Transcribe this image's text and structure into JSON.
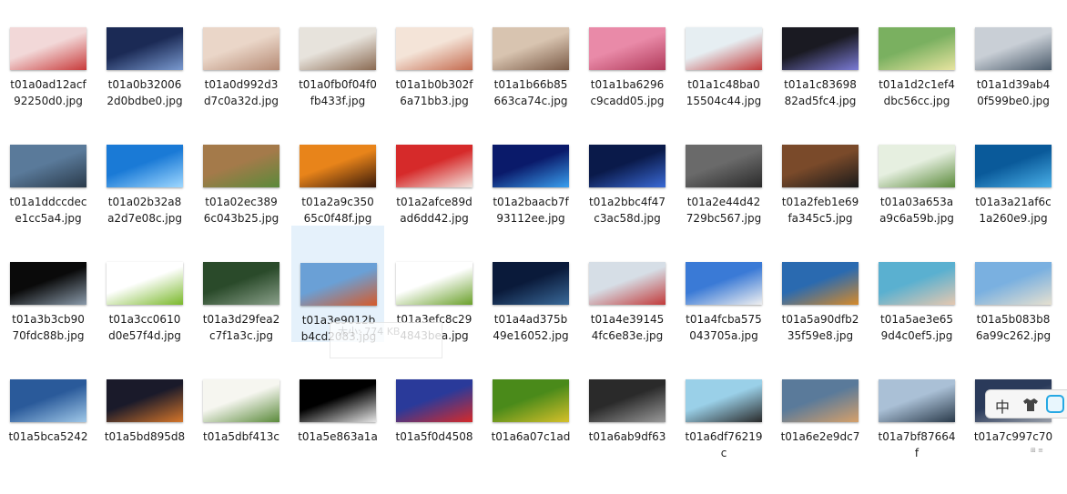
{
  "files": [
    {
      "name": "t01a0ad12acf92250d0.jpg",
      "icon": "photo-thumbnail",
      "colors": [
        "#f2d8d8",
        "#c83a3a"
      ]
    },
    {
      "name": "t01a0b320062d0bdbe0.jpg",
      "icon": "photo-thumbnail",
      "colors": [
        "#1b2a55",
        "#7a9ad0"
      ]
    },
    {
      "name": "t01a0d992d3d7c0a32d.jpg",
      "icon": "photo-thumbnail",
      "colors": [
        "#ead6c8",
        "#b58a74"
      ]
    },
    {
      "name": "t01a0fb0f04f0fb433f.jpg",
      "icon": "photo-thumbnail",
      "colors": [
        "#e7e3dc",
        "#8a6a52"
      ]
    },
    {
      "name": "t01a1b0b302f6a71bb3.jpg",
      "icon": "photo-thumbnail",
      "colors": [
        "#f4e4d8",
        "#c46a4e"
      ]
    },
    {
      "name": "t01a1b66b85663ca74c.jpg",
      "icon": "photo-thumbnail",
      "colors": [
        "#d8c4b0",
        "#7a5a46"
      ]
    },
    {
      "name": "t01a1ba6296c9cadd05.jpg",
      "icon": "photo-thumbnail",
      "colors": [
        "#e98aa8",
        "#b03a5a"
      ]
    },
    {
      "name": "t01a1c48ba015504c44.jpg",
      "icon": "photo-thumbnail",
      "colors": [
        "#e6eef2",
        "#c23a3a"
      ]
    },
    {
      "name": "t01a1c8369882ad5fc4.jpg",
      "icon": "photo-thumbnail",
      "colors": [
        "#1a1a22",
        "#7b7bd6"
      ]
    },
    {
      "name": "t01a1d2c1ef4dbc56cc.jpg",
      "icon": "photo-thumbnail",
      "colors": [
        "#7ab060",
        "#e8e4a0"
      ]
    },
    {
      "name": "t01a1d39ab40f599be0.jpg",
      "icon": "photo-thumbnail",
      "colors": [
        "#c9cfd6",
        "#4a5a6a"
      ]
    },
    {
      "name": "t01a1ddccdece1cc5a4.jpg",
      "icon": "photo-thumbnail",
      "colors": [
        "#5a7a9a",
        "#2a3a4a"
      ]
    },
    {
      "name": "t01a02b32a8a2d7e08c.jpg",
      "icon": "photo-thumbnail",
      "colors": [
        "#1a7ad6",
        "#9fd8ff"
      ]
    },
    {
      "name": "t01a02ec3896c043b25.jpg",
      "icon": "photo-thumbnail",
      "colors": [
        "#a47a4a",
        "#5a8a3a"
      ]
    },
    {
      "name": "t01a2a9c35065c0f48f.jpg",
      "icon": "photo-thumbnail",
      "colors": [
        "#e8841a",
        "#3a1a0a"
      ]
    },
    {
      "name": "t01a2afce89dad6dd42.jpg",
      "icon": "photo-thumbnail",
      "colors": [
        "#d62a2a",
        "#f2e6e0"
      ]
    },
    {
      "name": "t01a2baacb7f93112ee.jpg",
      "icon": "photo-thumbnail",
      "colors": [
        "#0a1a6a",
        "#3aa0f0"
      ]
    },
    {
      "name": "t01a2bbc4f47c3ac58d.jpg",
      "icon": "photo-thumbnail",
      "colors": [
        "#0a1a4a",
        "#3a6ad6"
      ]
    },
    {
      "name": "t01a2e44d42729bc567.jpg",
      "icon": "photo-thumbnail",
      "colors": [
        "#6a6a6a",
        "#2a2a2a"
      ]
    },
    {
      "name": "t01a2feb1e69fa345c5.jpg",
      "icon": "photo-thumbnail",
      "colors": [
        "#7a4a2a",
        "#1a1a1a"
      ]
    },
    {
      "name": "t01a03a653aa9c6a59b.jpg",
      "icon": "photo-thumbnail",
      "colors": [
        "#e6efe0",
        "#5a8a3a"
      ]
    },
    {
      "name": "t01a3a21af6c1a260e9.jpg",
      "icon": "photo-thumbnail",
      "colors": [
        "#0a5a9a",
        "#4ab0e8"
      ]
    },
    {
      "name": "t01a3b3cb9070fdc88b.jpg",
      "icon": "photo-thumbnail",
      "colors": [
        "#0a0a0a",
        "#8a9aaa"
      ]
    },
    {
      "name": "t01a3cc0610d0e57f4d.jpg",
      "icon": "photo-thumbnail",
      "colors": [
        "#ffffff",
        "#7ab82a"
      ]
    },
    {
      "name": "t01a3d29fea2c7f1a3c.jpg",
      "icon": "photo-thumbnail",
      "colors": [
        "#2a4a2a",
        "#8aa08a"
      ]
    },
    {
      "name": "t01a3e9012bb4cd2083.jpg",
      "icon": "photo-thumbnail",
      "colors": [
        "#6aa0d6",
        "#d65a2a"
      ]
    },
    {
      "name": "t01a3efc8c294843bea.jpg",
      "icon": "photo-thumbnail",
      "colors": [
        "#ffffff",
        "#6aa02a"
      ]
    },
    {
      "name": "t01a4ad375b49e16052.jpg",
      "icon": "photo-thumbnail",
      "colors": [
        "#0a1a3a",
        "#3a6a9a"
      ]
    },
    {
      "name": "t01a4e391454fc6e83e.jpg",
      "icon": "photo-thumbnail",
      "colors": [
        "#d6dee6",
        "#c23a3a"
      ]
    },
    {
      "name": "t01a4fcba575043705a.jpg",
      "icon": "photo-thumbnail",
      "colors": [
        "#3a7ad6",
        "#f0f0f0"
      ]
    },
    {
      "name": "t01a5a90dfb235f59e8.jpg",
      "icon": "photo-thumbnail",
      "colors": [
        "#2a6ab0",
        "#d68a2a"
      ]
    },
    {
      "name": "t01a5ae3e659d4c0ef5.jpg",
      "icon": "photo-thumbnail",
      "colors": [
        "#5ab0d0",
        "#e6c8b0"
      ]
    },
    {
      "name": "t01a5b083b86a99c262.jpg",
      "icon": "photo-thumbnail",
      "colors": [
        "#7ab0e0",
        "#e6e0d0"
      ]
    },
    {
      "name": "t01a5bca5242",
      "icon": "photo-thumbnail",
      "colors": [
        "#2a5a9a",
        "#a0c8e8"
      ]
    },
    {
      "name": "t01a5bd895d8",
      "icon": "photo-thumbnail",
      "colors": [
        "#1a1a2a",
        "#d6762a"
      ]
    },
    {
      "name": "t01a5dbf413c",
      "icon": "photo-thumbnail",
      "colors": [
        "#f6f6f0",
        "#5a8a3a"
      ]
    },
    {
      "name": "t01a5e863a1a",
      "icon": "photo-thumbnail",
      "colors": [
        "#000000",
        "#e6e6e6"
      ]
    },
    {
      "name": "t01a5f0d4508",
      "icon": "photo-thumbnail",
      "colors": [
        "#2a3a9a",
        "#d62a2a"
      ]
    },
    {
      "name": "t01a6a07c1ad",
      "icon": "photo-thumbnail",
      "colors": [
        "#4a8a1a",
        "#d6c02a"
      ]
    },
    {
      "name": "t01a6ab9df63",
      "icon": "photo-thumbnail",
      "colors": [
        "#2a2a2a",
        "#9a9a9a"
      ]
    },
    {
      "name": "t01a6df76219c",
      "icon": "photo-thumbnail",
      "colors": [
        "#9ad0e8",
        "#2a2a2a"
      ]
    },
    {
      "name": "t01a6e2e9dc7",
      "icon": "photo-thumbnail",
      "colors": [
        "#5a7a9a",
        "#d6a06a"
      ]
    },
    {
      "name": "t01a7bf87664f",
      "icon": "photo-thumbnail",
      "colors": [
        "#aac0d6",
        "#2a3a4a"
      ]
    },
    {
      "name": "t01a7c997c70",
      "icon": "photo-thumbnail",
      "colors": [
        "#2a3a5a",
        "#9aa0aa"
      ]
    }
  ],
  "selected_index": 25,
  "tooltip": {
    "line1": "",
    "line2": "大小: 774 KB"
  },
  "ime": {
    "lang": "中",
    "icons": [
      "shirt-icon",
      "skin-icon"
    ]
  },
  "corner_text": "⊞ ≡"
}
